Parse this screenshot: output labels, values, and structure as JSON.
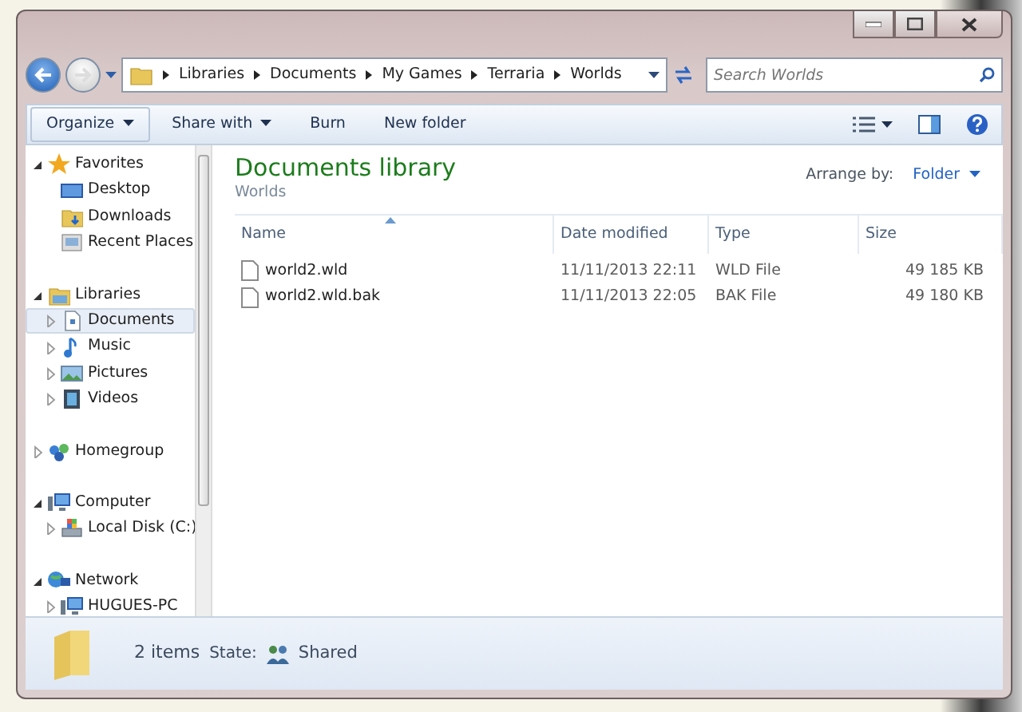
{
  "address": {
    "crumbs": [
      "Libraries",
      "Documents",
      "My Games",
      "Terraria",
      "Worlds"
    ]
  },
  "search": {
    "placeholder": "Search Worlds"
  },
  "toolbar": [
    {
      "label": "Organize",
      "dropdown": true
    },
    {
      "label": "Share with",
      "dropdown": true
    },
    {
      "label": "Burn",
      "dropdown": false
    },
    {
      "label": "New folder",
      "dropdown": false
    }
  ],
  "sidebar": {
    "items": [
      {
        "label": "Favorites",
        "kind": "star",
        "expanded": true,
        "selected": false,
        "children": [
          {
            "label": "Desktop",
            "kind": "desktop",
            "selected": false
          },
          {
            "label": "Downloads",
            "kind": "folder",
            "selected": false
          },
          {
            "label": "Recent Places",
            "kind": "recent",
            "selected": false
          }
        ]
      },
      {
        "label": "Libraries",
        "kind": "library",
        "expanded": true,
        "selected": false,
        "children": [
          {
            "label": "Documents",
            "kind": "document",
            "expanded": false,
            "selected": true
          },
          {
            "label": "Music",
            "kind": "music",
            "expanded": false,
            "selected": false
          },
          {
            "label": "Pictures",
            "kind": "picture",
            "expanded": false,
            "selected": false
          },
          {
            "label": "Videos",
            "kind": "video",
            "expanded": false,
            "selected": false
          }
        ]
      },
      {
        "label": "Homegroup",
        "kind": "homegroup",
        "expanded": false,
        "selected": false
      },
      {
        "label": "Computer",
        "kind": "computer",
        "expanded": true,
        "selected": false,
        "children": [
          {
            "label": "Local Disk (C:)",
            "kind": "disk",
            "expanded": false,
            "selected": false
          }
        ]
      },
      {
        "label": "Network",
        "kind": "network",
        "expanded": true,
        "selected": false,
        "children": [
          {
            "label": "HUGUES-PC",
            "kind": "computer",
            "expanded": false,
            "selected": false
          }
        ]
      }
    ]
  },
  "library": {
    "title": "Documents library",
    "subtitle": "Worlds",
    "arrange_label": "Arrange by:",
    "arrange_value": "Folder"
  },
  "table": {
    "columns": [
      {
        "label": "Name",
        "sorted": true
      },
      {
        "label": "Date modified",
        "sorted": false
      },
      {
        "label": "Type",
        "sorted": false
      },
      {
        "label": "Size",
        "sorted": false
      }
    ],
    "rows": [
      {
        "name": "world2.wld",
        "date": "11/11/2013 22:11",
        "type": "WLD File",
        "size": "49 185 KB"
      },
      {
        "name": "world2.wld.bak",
        "date": "11/11/2013 22:05",
        "type": "BAK File",
        "size": "49 180 KB"
      }
    ]
  },
  "status_bar": {
    "count": "2 items",
    "state_label": "State:",
    "state_value": "Shared"
  }
}
